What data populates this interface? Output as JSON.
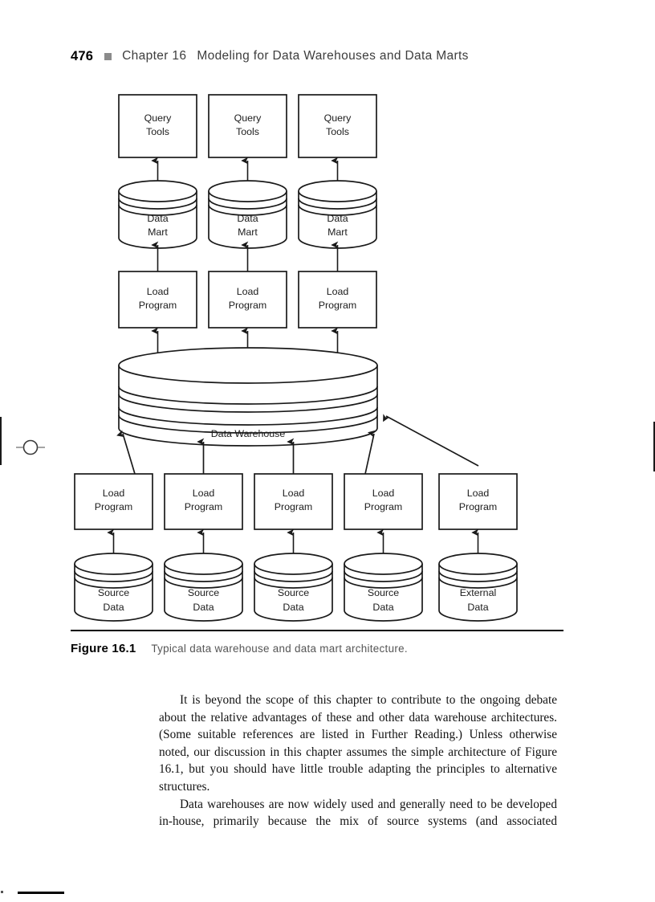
{
  "page": {
    "folio": "476",
    "running_head": "Chapter 16",
    "running_head_title": "Modeling for Data Warehouses and Data Marts",
    "marker_icon": "filled-square-bullet",
    "registration_mark_icon": "registration-circle-mark"
  },
  "figure": {
    "caption_label": "Figure 16.1",
    "caption_text": "Typical data warehouse and data mart architecture.",
    "nodes": {
      "query_tools": [
        "Query\nTools",
        "Query\nTools",
        "Query\nTools"
      ],
      "query_tools_line1": "Query",
      "query_tools_line2": "Tools",
      "data_mart_line1": "Data",
      "data_mart_line2": "Mart",
      "load_program_line1": "Load",
      "load_program_line2": "Program",
      "warehouse_label": "Data Warehouse",
      "source_data_line1": "Source",
      "source_data_line2": "Data",
      "external_data_line1": "External",
      "external_data_line2": "Data"
    },
    "tiers": {
      "top_boxes": [
        {
          "label_1": "Query",
          "label_2": "Tools"
        },
        {
          "label_1": "Query",
          "label_2": "Tools"
        },
        {
          "label_1": "Query",
          "label_2": "Tools"
        }
      ],
      "marts": [
        {
          "label_1": "Data",
          "label_2": "Mart"
        },
        {
          "label_1": "Data",
          "label_2": "Mart"
        },
        {
          "label_1": "Data",
          "label_2": "Mart"
        }
      ],
      "mart_loaders": [
        {
          "label_1": "Load",
          "label_2": "Program"
        },
        {
          "label_1": "Load",
          "label_2": "Program"
        },
        {
          "label_1": "Load",
          "label_2": "Program"
        }
      ],
      "warehouse": {
        "label": "Data Warehouse"
      },
      "source_loaders": [
        {
          "label_1": "Load",
          "label_2": "Program"
        },
        {
          "label_1": "Load",
          "label_2": "Program"
        },
        {
          "label_1": "Load",
          "label_2": "Program"
        },
        {
          "label_1": "Load",
          "label_2": "Program"
        },
        {
          "label_1": "Load",
          "label_2": "Program"
        }
      ],
      "sources": [
        {
          "label_1": "Source",
          "label_2": "Data"
        },
        {
          "label_1": "Source",
          "label_2": "Data"
        },
        {
          "label_1": "Source",
          "label_2": "Data"
        },
        {
          "label_1": "Source",
          "label_2": "Data"
        },
        {
          "label_1": "External",
          "label_2": "Data"
        }
      ]
    },
    "colors": {
      "stroke": "#1a1a1a",
      "fill": "#ffffff",
      "text": "#1c1c1c"
    }
  },
  "body": {
    "paragraph_1": "It is beyond the scope of this chapter to contribute to the ongoing debate about the relative advantages of these and other data warehouse architectures. (Some suitable references are listed in Further Reading.) Unless otherwise noted, our discussion in this chapter assumes the simple architecture of Figure 16.1, but you should have little trouble adapting the principles to alternative structures.",
    "paragraph_2": "Data warehouses are now widely used and generally need to be developed in-house, primarily because the mix of source systems (and associated"
  }
}
